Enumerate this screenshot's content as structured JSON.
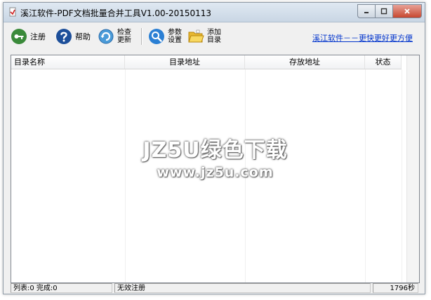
{
  "window": {
    "title": "溪江软件-PDF文档批量合并工具V1.00-20150113"
  },
  "toolbar": {
    "register": "注册",
    "help": "帮助",
    "check_update": "检查更新",
    "settings": "参数设置",
    "add_dir": "添加目录",
    "link": "溪江软件－－更快更好更方便"
  },
  "list": {
    "columns": [
      "目录名称",
      "目录地址",
      "存放地址",
      "状态"
    ],
    "rows": []
  },
  "watermark": {
    "line1": "JZ5U绿色下载",
    "line2": "www.jz5u.com"
  },
  "status": {
    "counts": "列表:0  完成:0",
    "registration": "无效注册",
    "timer": "1796秒"
  },
  "colors": {
    "link": "#0033cc",
    "close_button": "#c7472f"
  },
  "icons": [
    "app-icon",
    "key-icon",
    "help-icon",
    "update-icon",
    "settings-icon",
    "folder-icon"
  ]
}
